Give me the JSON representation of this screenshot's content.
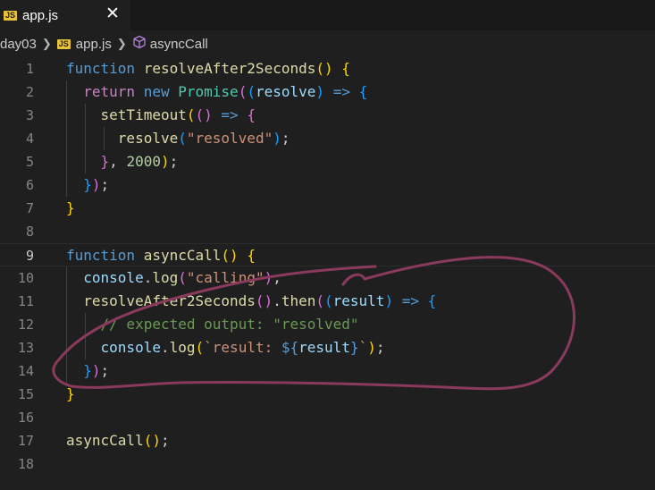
{
  "tab": {
    "icon": "JS",
    "label": "app.js",
    "close": "✕"
  },
  "breadcrumb": {
    "folder": "day03",
    "file_icon": "JS",
    "file": "app.js",
    "symbol": "asyncCall"
  },
  "code": {
    "line_numbers": [
      "1",
      "2",
      "3",
      "4",
      "5",
      "6",
      "7",
      "8",
      "9",
      "10",
      "11",
      "12",
      "13",
      "14",
      "15",
      "16",
      "17",
      "18"
    ],
    "tokens": {
      "function": "function",
      "return": "return",
      "new": "new",
      "resolveAfter2Seconds": "resolveAfter2Seconds",
      "Promise": "Promise",
      "resolve": "resolve",
      "setTimeout": "setTimeout",
      "arrow": "=>",
      "resolved_str": "\"resolved\"",
      "delay": "2000",
      "asyncCall": "asyncCall",
      "console": "console",
      "log": "log",
      "calling_str": "\"calling\"",
      "then": "then",
      "result": "result",
      "comment": "// expected output: \"resolved\"",
      "tpl_open": "`result: ",
      "tpl_expr_open": "${",
      "tpl_expr_close": "}",
      "tpl_close": "`"
    }
  },
  "annotation": {
    "color": "#8a3a5c"
  }
}
